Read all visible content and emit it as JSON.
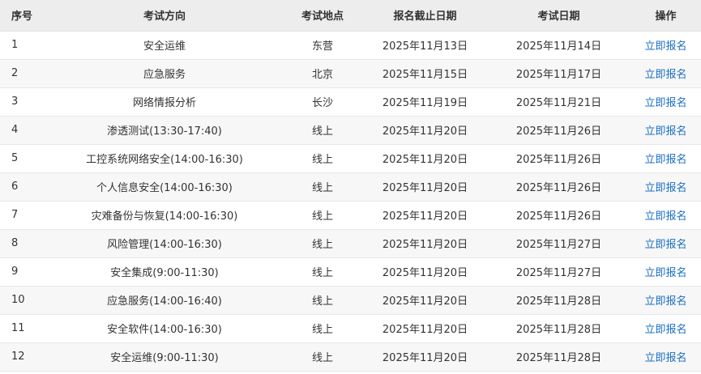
{
  "table": {
    "headers": {
      "no": "序号",
      "direction": "考试方向",
      "location": "考试地点",
      "deadline": "报名截止日期",
      "exam_date": "考试日期",
      "action": "操作"
    },
    "rows": [
      {
        "no": "1",
        "direction": "安全运维",
        "location": "东营",
        "deadline": "2025年11月13日",
        "exam_date": "2025年11月14日",
        "action": "立即报名"
      },
      {
        "no": "2",
        "direction": "应急服务",
        "location": "北京",
        "deadline": "2025年11月15日",
        "exam_date": "2025年11月17日",
        "action": "立即报名"
      },
      {
        "no": "3",
        "direction": "网络情报分析",
        "location": "长沙",
        "deadline": "2025年11月19日",
        "exam_date": "2025年11月21日",
        "action": "立即报名"
      },
      {
        "no": "4",
        "direction": "渗透测试(13:30-17:40)",
        "location": "线上",
        "deadline": "2025年11月20日",
        "exam_date": "2025年11月26日",
        "action": "立即报名"
      },
      {
        "no": "5",
        "direction": "工控系统网络安全(14:00-16:30)",
        "location": "线上",
        "deadline": "2025年11月20日",
        "exam_date": "2025年11月26日",
        "action": "立即报名"
      },
      {
        "no": "6",
        "direction": "个人信息安全(14:00-16:30)",
        "location": "线上",
        "deadline": "2025年11月20日",
        "exam_date": "2025年11月26日",
        "action": "立即报名"
      },
      {
        "no": "7",
        "direction": "灾难备份与恢复(14:00-16:30)",
        "location": "线上",
        "deadline": "2025年11月20日",
        "exam_date": "2025年11月26日",
        "action": "立即报名"
      },
      {
        "no": "8",
        "direction": "风险管理(14:00-16:30)",
        "location": "线上",
        "deadline": "2025年11月20日",
        "exam_date": "2025年11月27日",
        "action": "立即报名"
      },
      {
        "no": "9",
        "direction": "安全集成(9:00-11:30)",
        "location": "线上",
        "deadline": "2025年11月20日",
        "exam_date": "2025年11月27日",
        "action": "立即报名"
      },
      {
        "no": "10",
        "direction": "应急服务(14:00-16:40)",
        "location": "线上",
        "deadline": "2025年11月20日",
        "exam_date": "2025年11月28日",
        "action": "立即报名"
      },
      {
        "no": "11",
        "direction": "安全软件(14:00-16:30)",
        "location": "线上",
        "deadline": "2025年11月20日",
        "exam_date": "2025年11月28日",
        "action": "立即报名"
      },
      {
        "no": "12",
        "direction": "安全运维(9:00-11:30)",
        "location": "线上",
        "deadline": "2025年11月20日",
        "exam_date": "2025年11月28日",
        "action": "立即报名"
      }
    ]
  },
  "colors": {
    "header_bg": "#ededed",
    "stripe_bg": "#f7f7f7",
    "link": "#1a6fc4",
    "text": "#333333"
  }
}
